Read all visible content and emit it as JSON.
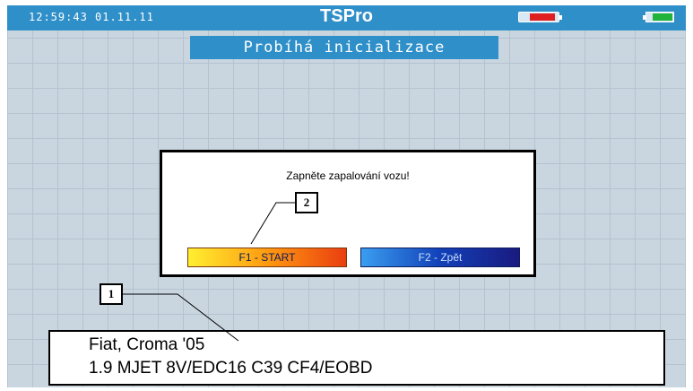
{
  "statusbar": {
    "clock": "12:59:43 01.11.11",
    "app_title": "TSPro",
    "battery_external_icon": "battery-external-icon",
    "battery_internal_icon": "battery-internal-icon"
  },
  "status_banner": "Probíhá inicializace",
  "dialog": {
    "message": "Zapněte zapalování vozu!",
    "start_button": "F1 - START",
    "back_button": "F2 - Zpět"
  },
  "vehicle": {
    "line1": "Fiat, Croma '05",
    "line2": "1.9 MJET 8V/EDC16 C39 CF4/EOBD"
  },
  "callouts": [
    "1",
    "2"
  ],
  "colors": {
    "statusbar": "#2f8fc8",
    "grid_background": "#c9d6e0",
    "start_gradient": "#ff9a10",
    "back_gradient": "#1240b8"
  }
}
